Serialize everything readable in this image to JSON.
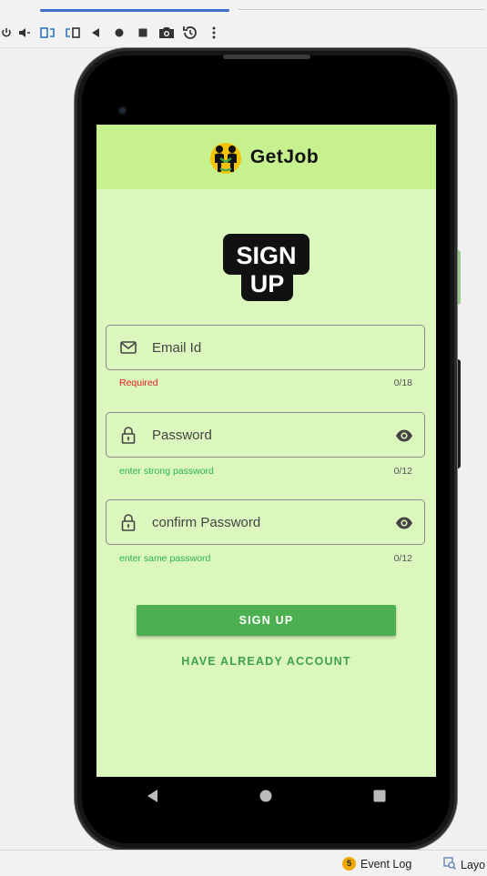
{
  "toolbar": {
    "icons": [
      "power-icon",
      "volume-icon",
      "rotate-left-icon",
      "rotate-right-icon",
      "back-icon",
      "home-icon",
      "overview-icon",
      "camera-icon",
      "snapshot-icon",
      "more-icon"
    ]
  },
  "app": {
    "brand_name": "GetJob",
    "signup_logo": {
      "line1": "SIGN",
      "line2": "UP"
    },
    "email": {
      "label": "Email Id",
      "helper": "Required",
      "counter": "0/18"
    },
    "password": {
      "label": "Password",
      "helper": "enter strong password",
      "counter": "0/12"
    },
    "confirm_password": {
      "label": "confirm Password",
      "helper": "enter same password",
      "counter": "0/12"
    },
    "signup_button": "SIGN UP",
    "login_link": "HAVE ALREADY ACCOUNT",
    "colors": {
      "header_bg": "#c7f08f",
      "screen_bg": "#dcf7bd",
      "button_bg": "#4caf50",
      "error_text": "#e02020",
      "helper_text": "#2cb44a"
    }
  },
  "system_nav": [
    "back-icon",
    "home-icon",
    "recents-icon"
  ],
  "statusbar": {
    "event_log_count": "5",
    "event_log_label": "Event Log",
    "layout_label": "Layo"
  }
}
